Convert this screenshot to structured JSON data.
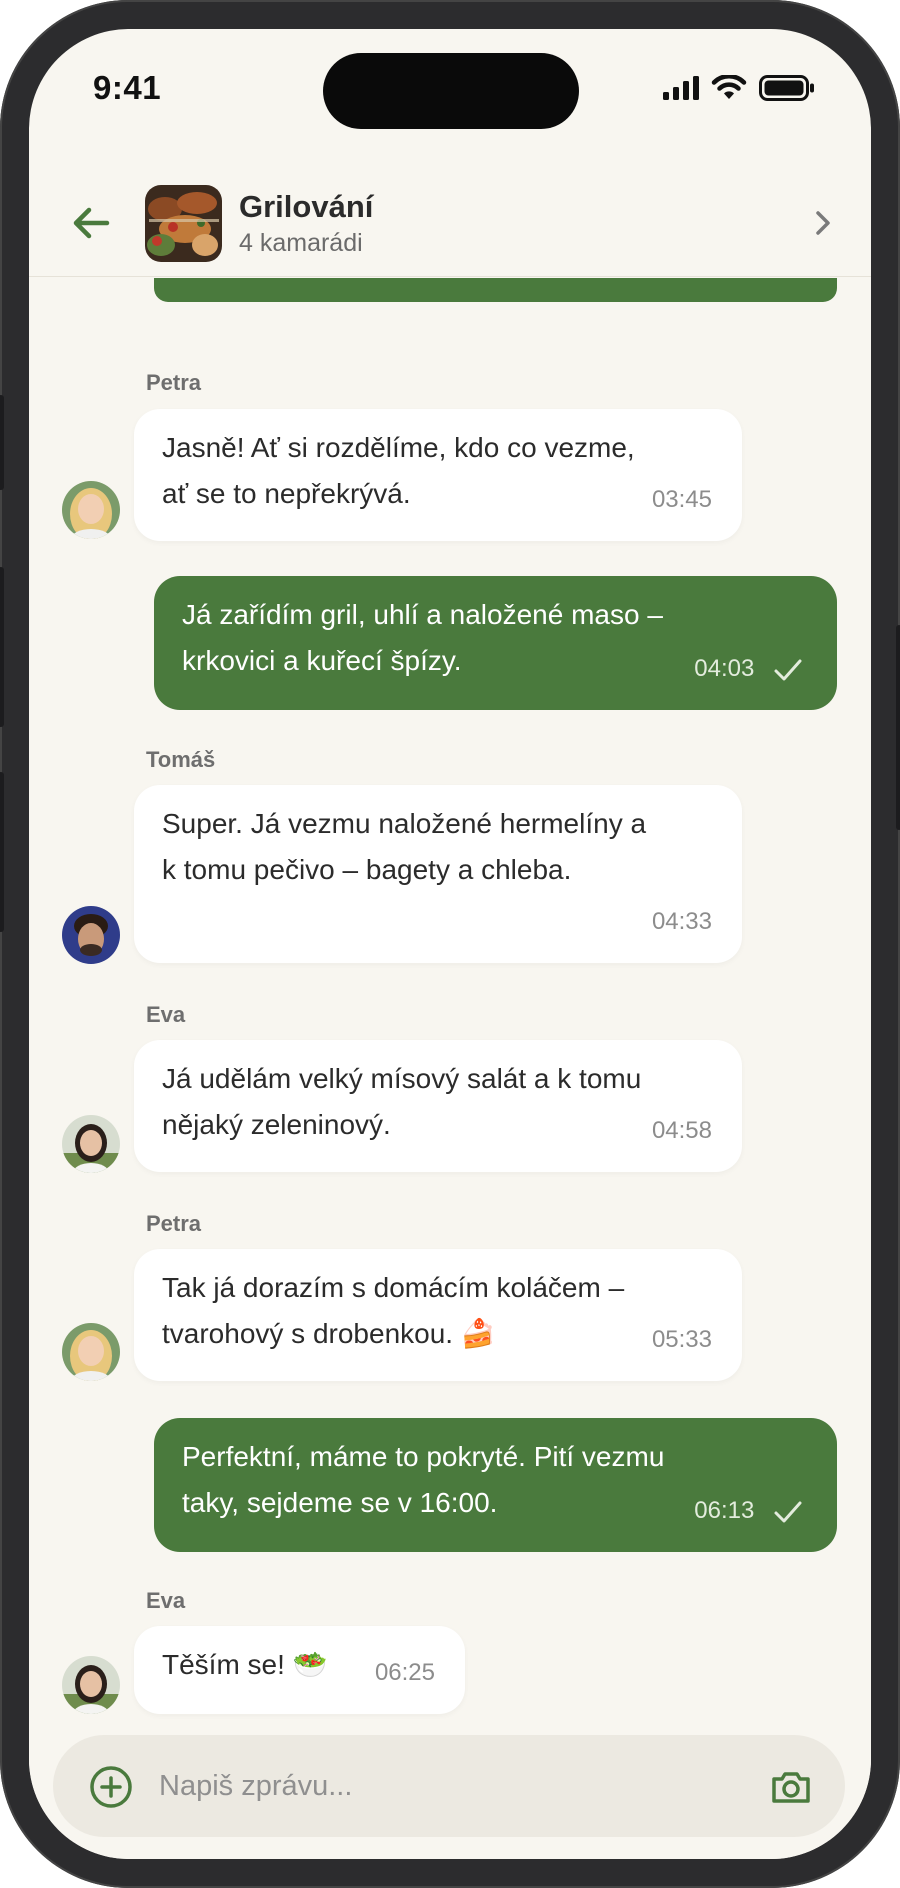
{
  "status_bar": {
    "time": "9:41"
  },
  "header": {
    "title": "Grilování",
    "subtitle": "4 kamarádi",
    "back_icon": "arrow-left-icon",
    "details_icon": "chevron-right-icon"
  },
  "messages": [
    {
      "sender": "Petra",
      "text_line1": "Jasně! Ať si rozdělíme, kdo co vezme,",
      "text_line2": "ať se to nepřekrývá.",
      "time": "03:45",
      "direction": "in"
    },
    {
      "text_line1": "Já zařídím gril, uhlí a naložené maso –",
      "text_line2": "krkovici a kuřecí špízy.",
      "time": "04:03",
      "direction": "out",
      "status_icon": "checkmark-icon"
    },
    {
      "sender": "Tomáš",
      "text_line1": "Super. Já vezmu naložené hermelíny a",
      "text_line2": "k tomu pečivo – bagety a chleba.",
      "time": "04:33",
      "direction": "in"
    },
    {
      "sender": "Eva",
      "text_line1": "Já udělám velký mísový salát a k tomu",
      "text_line2": "nějaký zeleninový.",
      "time": "04:58",
      "direction": "in"
    },
    {
      "sender": "Petra",
      "text_line1": "Tak já dorazím s domácím koláčem –",
      "text_line2": "tvarohový s drobenkou.",
      "emoji": "🍰",
      "time": "05:33",
      "direction": "in"
    },
    {
      "text_line1": "Perfektní, máme to pokryté. Pití vezmu",
      "text_line2": "taky, sejdeme se v 16:00.",
      "time": "06:13",
      "direction": "out",
      "status_icon": "checkmark-icon"
    },
    {
      "sender": "Eva",
      "text_line1": "Těším se!",
      "emoji": "🥗",
      "time": "06:25",
      "direction": "in"
    }
  ],
  "composer": {
    "placeholder": "Napiš zprávu...",
    "add_icon": "plus-circle-icon",
    "camera_icon": "camera-icon"
  },
  "colors": {
    "accent": "#4a7a3d",
    "background": "#f8f6f0",
    "bubble_in": "#ffffff"
  }
}
